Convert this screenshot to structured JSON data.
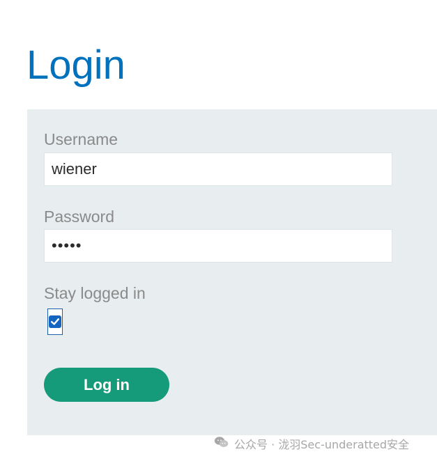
{
  "page": {
    "title": "Login"
  },
  "form": {
    "username_label": "Username",
    "username_value": "wiener",
    "password_label": "Password",
    "password_value": "peter",
    "stay_logged_in_label": "Stay logged in",
    "stay_logged_in_checked": true,
    "submit_label": "Log in"
  },
  "watermark": {
    "text": "公众号 · 泷羽Sec-underatted安全",
    "icon": "wechat-icon"
  },
  "colors": {
    "title": "#0071bc",
    "panel_background": "#e8edf0",
    "label": "#8a8a8a",
    "button": "#159a7a",
    "checkbox": "#1565c0"
  }
}
